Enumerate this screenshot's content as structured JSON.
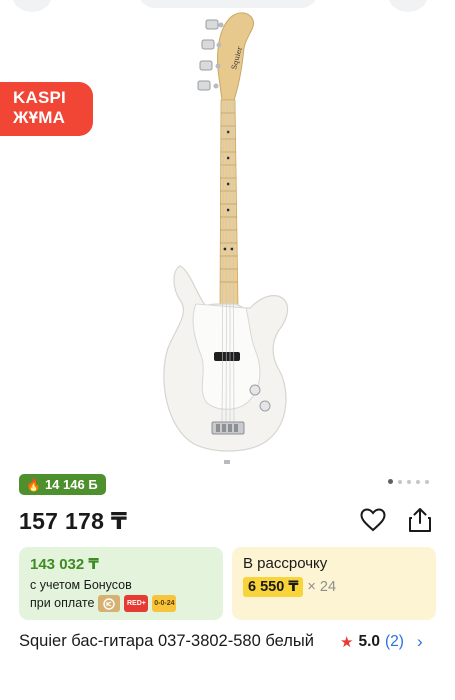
{
  "promo": {
    "badge_line1": "KASPI",
    "badge_line2": "ЖҰМА",
    "color": "#f14635"
  },
  "gallery": {
    "image": "white-bass-guitar",
    "page_count": 5,
    "active_index": 0
  },
  "bonus_badge": {
    "icon": "flame-icon",
    "value": "14 146 Б"
  },
  "price": "157 178 ₸",
  "actions": {
    "favorite_icon": "heart-outline-icon",
    "share_icon": "share-icon"
  },
  "bonus_card": {
    "price": "143 032 ₸",
    "note": "с учетом Бонусов",
    "pay_label": "при оплате",
    "chips": [
      {
        "name": "kaspi-gold-chip",
        "label": ""
      },
      {
        "name": "kaspi-red-chip",
        "label": "RED+"
      },
      {
        "name": "kaspi-credit-chip",
        "label": "0-0-24"
      }
    ]
  },
  "installment_card": {
    "label": "В рассрочку",
    "amount": "6 550 ₸",
    "times": "× 24"
  },
  "product": {
    "title": "Squier бас-гитара 037-3802-580 белый",
    "rating": "5.0",
    "reviews": "(2)"
  }
}
